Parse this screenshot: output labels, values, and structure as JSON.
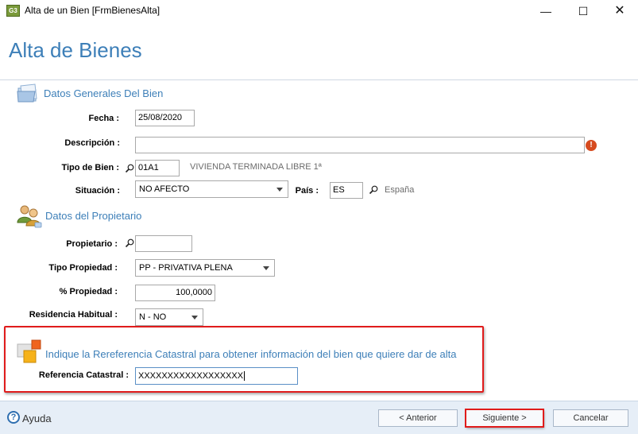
{
  "window": {
    "app_icon": "G3",
    "title": "Alta de un Bien [FrmBienesAlta]",
    "minimize": "—",
    "maximize": "☐",
    "close": "✕"
  },
  "page": {
    "title": "Alta de Bienes"
  },
  "general": {
    "section_title": "Datos Generales Del Bien",
    "fecha_label": "Fecha :",
    "fecha_value": "25/08/2020",
    "descripcion_label": "Descripción :",
    "descripcion_value": "",
    "tipo_bien_label": "Tipo de Bien :",
    "tipo_bien_value": "01A1",
    "tipo_bien_desc": "VIVIENDA TERMINADA LIBRE 1ª",
    "situacion_label": "Situación :",
    "situacion_value": "NO AFECTO",
    "pais_label": "País :",
    "pais_value": "ES",
    "pais_desc": "España",
    "error_icon": "!"
  },
  "owner": {
    "section_title": "Datos del Propietario",
    "propietario_label": "Propietario :",
    "propietario_value": "",
    "tipo_propiedad_label": "Tipo Propiedad :",
    "tipo_propiedad_value": "PP - PRIVATIVA PLENA",
    "pct_propiedad_label": "% Propiedad :",
    "pct_propiedad_value": "100,0000",
    "residencia_label": "Residencia Habitual :",
    "residencia_value": "N - NO"
  },
  "catastral": {
    "title": "Indique la Rereferencia Catastral para obtener información del bien que quiere dar de alta",
    "label": "Referencia Catastral :",
    "value": "XXXXXXXXXXXXXXXXXX"
  },
  "footer": {
    "help_icon": "?",
    "help_label": "Ayuda",
    "prev_label": "<  Anterior",
    "next_label": "Siguiente  >",
    "cancel_label": "Cancelar"
  },
  "colors": {
    "accent": "#3d7fb8",
    "highlight": "#e01b1b",
    "footer_bg": "#e6eef7"
  }
}
